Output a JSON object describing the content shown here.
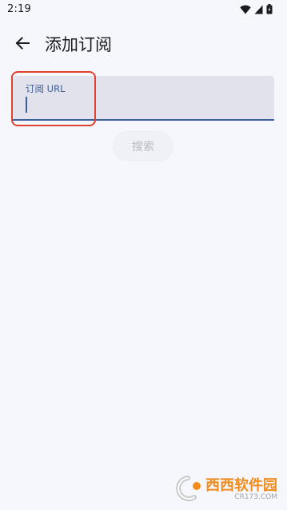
{
  "status_bar": {
    "time": "2:19",
    "icons": [
      "wifi-icon",
      "signal-icon",
      "battery-icon"
    ]
  },
  "app_bar": {
    "back_icon": "arrow-left-icon",
    "title": "添加订阅"
  },
  "subscription_field": {
    "label": "订阅 URL",
    "value": "",
    "placeholder": ""
  },
  "search_button": {
    "label": "搜索"
  },
  "watermark": {
    "brand": "西西软件园",
    "domain": "CR173.COM"
  },
  "colors": {
    "background": "#f6f7fd",
    "field_background": "#e1e2ec",
    "accent": "#3d5e96",
    "highlight": "#e0402e",
    "disabled_text": "#b9bac0"
  }
}
